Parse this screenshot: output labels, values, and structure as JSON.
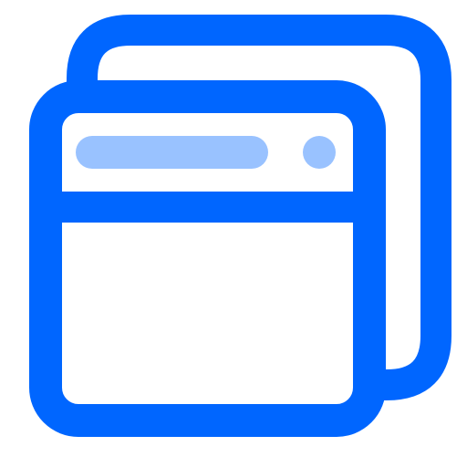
{
  "icon": {
    "name": "browser-windows-icon",
    "description_label": "",
    "colors": {
      "primary": "#0066FF",
      "secondary": "#99C2FF",
      "background": "#FFFFFF"
    }
  }
}
